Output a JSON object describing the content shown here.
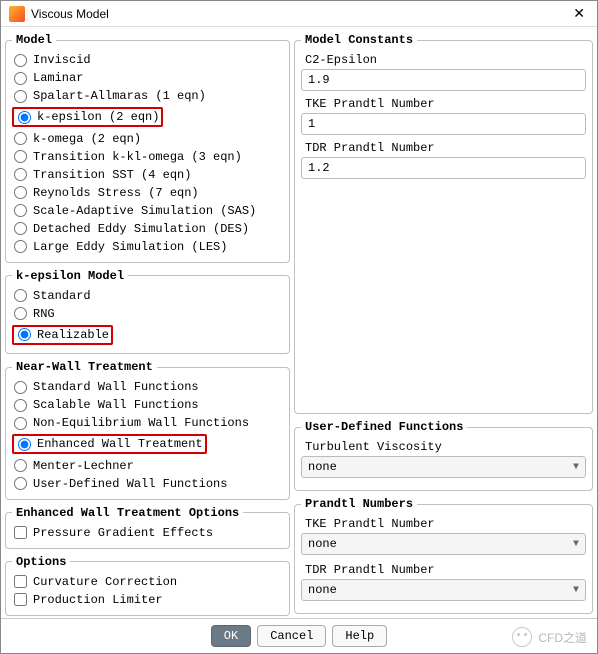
{
  "window": {
    "title": "Viscous Model"
  },
  "model": {
    "legend": "Model",
    "options": [
      {
        "label": "Inviscid",
        "selected": false,
        "highlight": false
      },
      {
        "label": "Laminar",
        "selected": false,
        "highlight": false
      },
      {
        "label": "Spalart-Allmaras (1 eqn)",
        "selected": false,
        "highlight": false
      },
      {
        "label": "k-epsilon (2 eqn)",
        "selected": true,
        "highlight": true
      },
      {
        "label": "k-omega (2 eqn)",
        "selected": false,
        "highlight": false
      },
      {
        "label": "Transition k-kl-omega (3 eqn)",
        "selected": false,
        "highlight": false
      },
      {
        "label": "Transition SST (4 eqn)",
        "selected": false,
        "highlight": false
      },
      {
        "label": "Reynolds Stress (7 eqn)",
        "selected": false,
        "highlight": false
      },
      {
        "label": "Scale-Adaptive Simulation (SAS)",
        "selected": false,
        "highlight": false
      },
      {
        "label": "Detached Eddy Simulation (DES)",
        "selected": false,
        "highlight": false
      },
      {
        "label": "Large Eddy Simulation (LES)",
        "selected": false,
        "highlight": false
      }
    ]
  },
  "ke_model": {
    "legend": "k-epsilon Model",
    "options": [
      {
        "label": "Standard",
        "selected": false,
        "highlight": false
      },
      {
        "label": "RNG",
        "selected": false,
        "highlight": false
      },
      {
        "label": "Realizable",
        "selected": true,
        "highlight": true
      }
    ]
  },
  "nwt": {
    "legend": "Near-Wall Treatment",
    "options": [
      {
        "label": "Standard Wall Functions",
        "selected": false,
        "highlight": false
      },
      {
        "label": "Scalable Wall Functions",
        "selected": false,
        "highlight": false
      },
      {
        "label": "Non-Equilibrium Wall Functions",
        "selected": false,
        "highlight": false
      },
      {
        "label": "Enhanced Wall Treatment",
        "selected": true,
        "highlight": true
      },
      {
        "label": "Menter-Lechner",
        "selected": false,
        "highlight": false
      },
      {
        "label": "User-Defined Wall Functions",
        "selected": false,
        "highlight": false
      }
    ]
  },
  "ewt_options": {
    "legend": "Enhanced Wall Treatment Options",
    "options": [
      {
        "label": "Pressure Gradient Effects",
        "checked": false
      }
    ]
  },
  "options": {
    "legend": "Options",
    "options": [
      {
        "label": "Curvature Correction",
        "checked": false
      },
      {
        "label": "Production Limiter",
        "checked": false
      }
    ]
  },
  "constants": {
    "legend": "Model Constants",
    "fields": [
      {
        "label": "C2-Epsilon",
        "value": "1.9"
      },
      {
        "label": "TKE Prandtl Number",
        "value": "1"
      },
      {
        "label": "TDR Prandtl Number",
        "value": "1.2"
      }
    ]
  },
  "udf": {
    "legend": "User-Defined Functions",
    "fields": [
      {
        "label": "Turbulent Viscosity",
        "value": "none"
      }
    ]
  },
  "prandtl": {
    "legend": "Prandtl Numbers",
    "fields": [
      {
        "label": "TKE Prandtl Number",
        "value": "none"
      },
      {
        "label": "TDR Prandtl Number",
        "value": "none"
      }
    ]
  },
  "footer": {
    "ok": "OK",
    "cancel": "Cancel",
    "help": "Help"
  },
  "watermark": "CFD之道"
}
